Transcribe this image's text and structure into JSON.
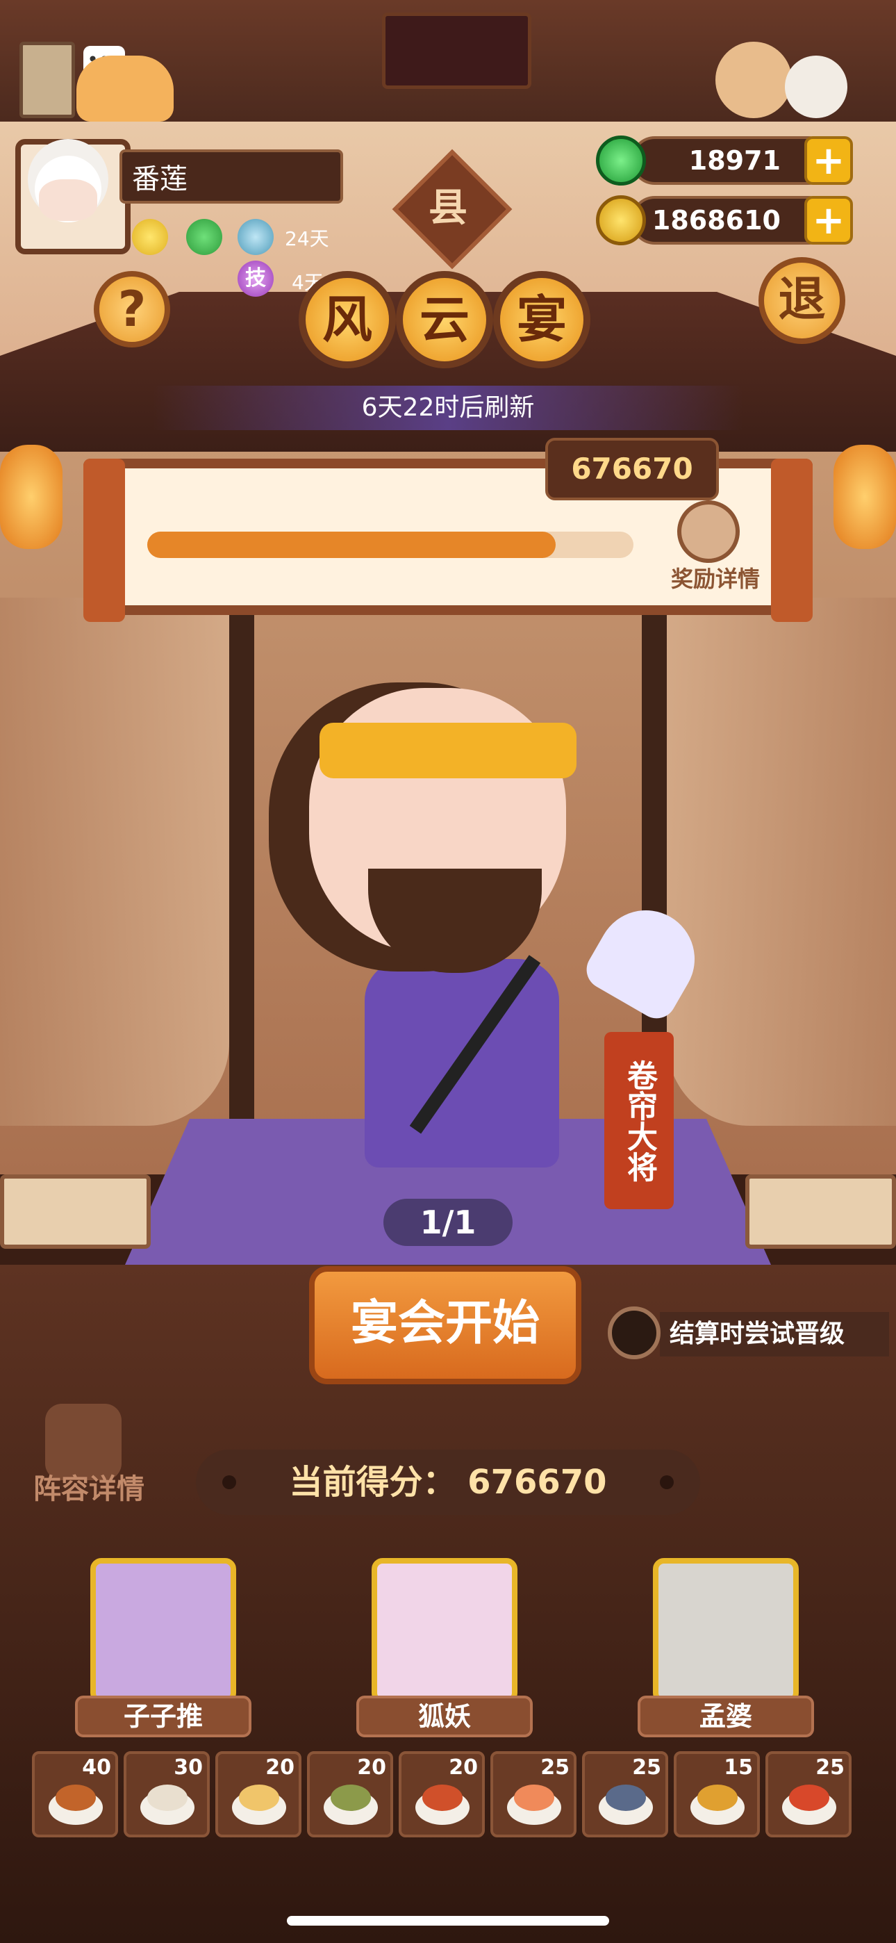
{
  "player": {
    "name": "番莲"
  },
  "status": {
    "buff1_days": "24天",
    "buff2_icon_text": "技",
    "buff2_days": "4天"
  },
  "resources": {
    "jade": "18971",
    "coins": "1868610"
  },
  "buttons": {
    "help": "?",
    "exit": "退"
  },
  "rank_badge": "县",
  "event": {
    "title_chars": [
      "风",
      "云",
      "宴"
    ],
    "refresh": "6天22时后刷新"
  },
  "progress": {
    "score": "676670",
    "fill_fraction": 0.84,
    "reward_label": "奖励详情"
  },
  "guest": {
    "name": "卷帘大将",
    "page": "1/1"
  },
  "actions": {
    "start": "宴会开始",
    "toggle_label": "结算时尝试晋级",
    "formation": "阵容详情"
  },
  "current_score": {
    "label": "当前得分：",
    "value": "676670"
  },
  "chefs": [
    {
      "name": "子子推",
      "color": "#c9a9e0"
    },
    {
      "name": "狐妖",
      "color": "#f1d5e8"
    },
    {
      "name": "孟婆",
      "color": "#d8d5cf"
    }
  ],
  "dishes": [
    {
      "count": "40",
      "color": "#c2642a"
    },
    {
      "count": "30",
      "color": "#e9dfcf"
    },
    {
      "count": "20",
      "color": "#f0c56a"
    },
    {
      "count": "20",
      "color": "#8c9a4a"
    },
    {
      "count": "20",
      "color": "#d0502a"
    },
    {
      "count": "25",
      "color": "#f08a5a"
    },
    {
      "count": "25",
      "color": "#5a6a8a"
    },
    {
      "count": "15",
      "color": "#e0a030"
    },
    {
      "count": "25",
      "color": "#d8482a"
    }
  ]
}
